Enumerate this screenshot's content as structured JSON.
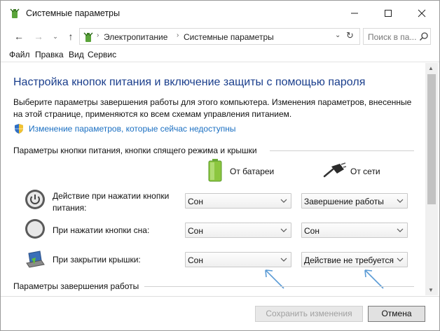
{
  "window": {
    "title": "Системные параметры",
    "controls": {
      "minimize": "—",
      "maximize": "☐",
      "close": "✕"
    }
  },
  "address": {
    "back": "←",
    "forward": "→",
    "recent": "⌄",
    "up": "↑",
    "sep": "›",
    "crumbs": [
      "Электропитание",
      "Системные параметры"
    ],
    "dropdown": "⌄",
    "refresh": "↻",
    "search_placeholder": "Поиск в пa..."
  },
  "menu": [
    "Файл",
    "Правка",
    "Вид",
    "Сервис"
  ],
  "page": {
    "title": "Настройка кнопок питания и включение защиты с помощью пароля",
    "description": "Выберите параметры завершения работы для этого компьютера. Изменения параметров, внесенные на этой странице, применяются ко всем схемам управления питанием.",
    "change_link": "Изменение параметров, которые сейчас недоступны",
    "section_buttons": "Параметры кнопки питания, кнопки спящего режима и крышки",
    "section_shutdown": "Параметры завершения работы",
    "col_battery": "От батареи",
    "col_plugged": "От сети",
    "rows": [
      {
        "label_line1": "Действие при нажатии кнопки",
        "label_line2": "питания:",
        "battery": "Сон",
        "plugged": "Завершение работы",
        "icon": "power-button-icon"
      },
      {
        "label_line1": "При нажатии кнопки сна:",
        "label_line2": "",
        "battery": "Сон",
        "plugged": "Сон",
        "icon": "sleep-button-icon"
      },
      {
        "label_line1": "При закрытии крышки:",
        "label_line2": "",
        "battery": "Сон",
        "plugged": "Действие не требуется",
        "icon": "laptop-lid-icon"
      }
    ]
  },
  "footer": {
    "save": "Сохранить изменения",
    "cancel": "Отмена"
  },
  "scrollbar": {
    "up": "▲",
    "down": "▼"
  },
  "colors": {
    "title_blue": "#1a3e8c",
    "link_blue": "#1a6fc2",
    "annotation_arrow": "#5b9bd5"
  }
}
